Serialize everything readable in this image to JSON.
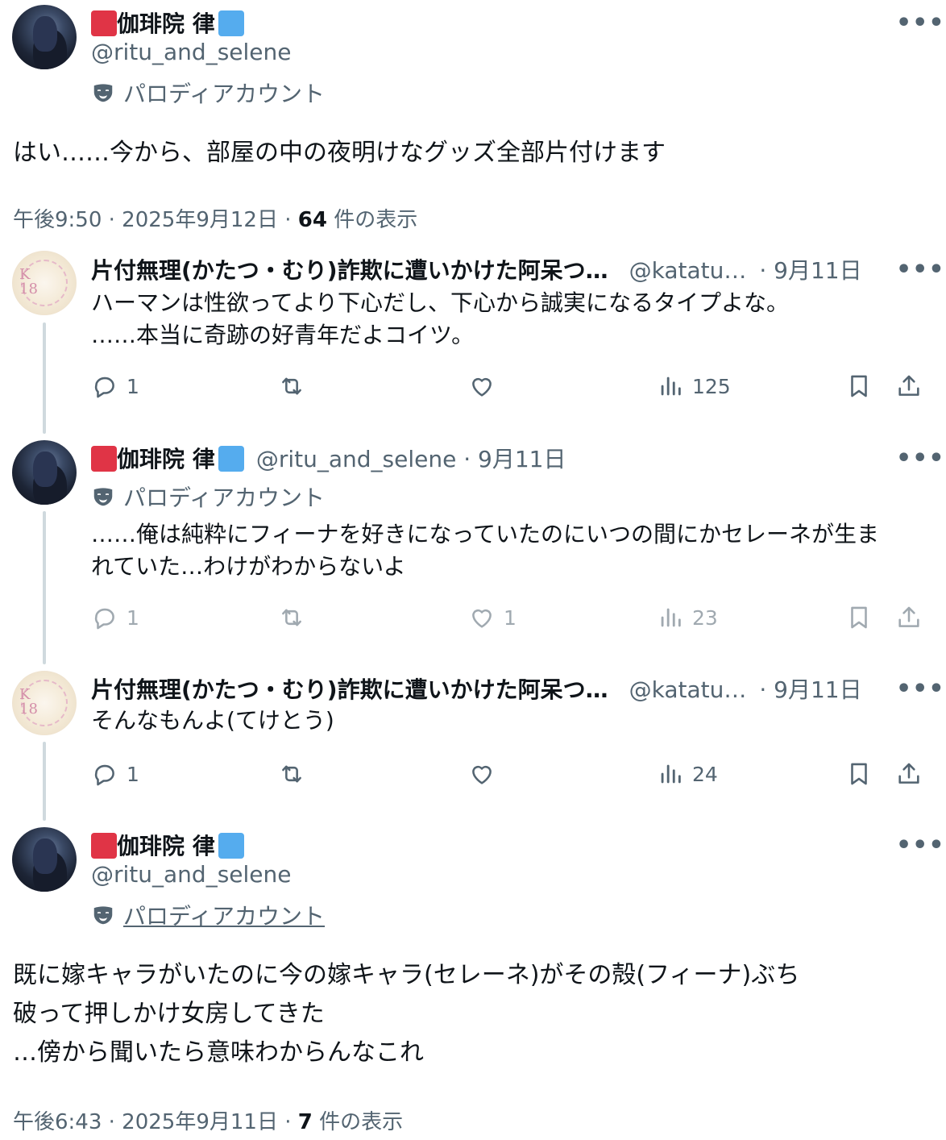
{
  "main_tweet": {
    "name": "伽琲院 律",
    "handle": "@ritu_and_selene",
    "label": "パロディアカウント",
    "text": "はい……今から、部屋の中の夜明けなグッズ全部片付けます",
    "time": "午後9:50 · 2025年9月12日 · ",
    "views_count": "64",
    "views_suffix": " 件の表示"
  },
  "replies": [
    {
      "name": "片付無理(かたつ・むり)詐欺に遭いかけた阿呆つ…",
      "handle": "@katatu…",
      "date": "· 9月11日",
      "text_line1": "ハーマンは性欲ってより下心だし、下心から誠実になるタイプよな。",
      "text_line2": "……本当に奇跡の好青年だよコイツ。",
      "stats": {
        "replies": "1",
        "retweets": "",
        "likes": "",
        "views": "125"
      }
    },
    {
      "name": "伽琲院 律",
      "handle": "@ritu_and_selene · 9月11日",
      "label": "パロディアカウント",
      "text_line1": "……俺は純粋にフィーナを好きになっていたのにいつの間にかセレーネが生ま",
      "text_line2": "れていた…わけがわからないよ",
      "stats": {
        "replies": "1",
        "retweets": "",
        "likes": "1",
        "views": "23"
      }
    },
    {
      "name": "片付無理(かたつ・むり)詐欺に遭いかけた阿呆つ…",
      "handle": "@katatu…",
      "date": "· 9月11日",
      "text_line1": "そんなもんよ(てけとう)",
      "stats": {
        "replies": "1",
        "retweets": "",
        "likes": "",
        "views": "24"
      }
    }
  ],
  "quoted_tweet": {
    "name": "伽琲院 律",
    "handle": "@ritu_and_selene",
    "label": "パロディアカウント",
    "text_line1": "既に嫁キャラがいたのに今の嫁キャラ(セレーネ)がその殻(フィーナ)ぶち",
    "text_line2": "破って押しかけ女房してきた",
    "text_line3": "…傍から聞いたら意味わからんなこれ",
    "time": "午後6:43 · 2025年9月11日 · ",
    "views_count": "7",
    "views_suffix": " 件の表示"
  },
  "colors": {
    "text": "#0f1419",
    "secondary": "#536471",
    "thread": "#cfd9de",
    "flag_red": "#e03446",
    "flag_blue": "#55acee"
  },
  "icons": [
    "more-icon",
    "parody-mask-icon",
    "reply-icon",
    "retweet-icon",
    "like-icon",
    "views-icon",
    "bookmark-icon",
    "share-icon"
  ]
}
